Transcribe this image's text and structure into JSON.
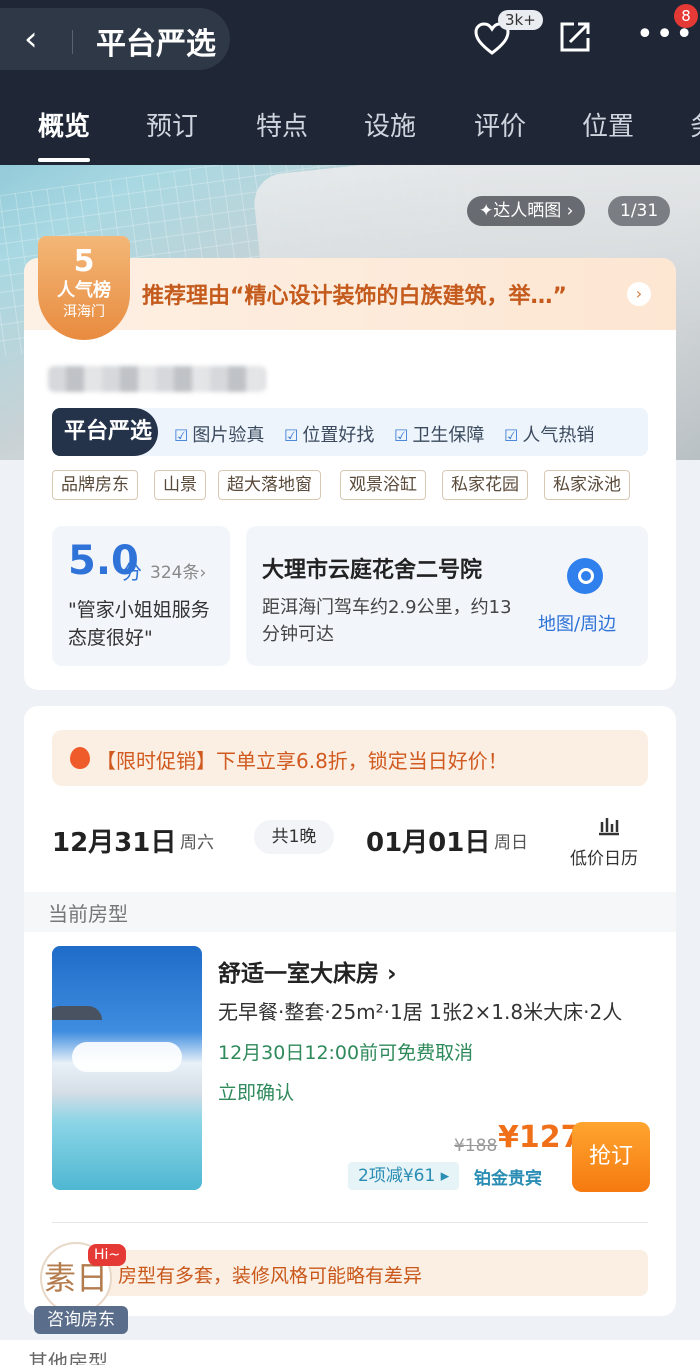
{
  "header": {
    "brand_title": "平台严选",
    "favorites_count": "3k+",
    "notification_count": "8",
    "more_label": "•••"
  },
  "tabs": [
    "概览",
    "预订",
    "特点",
    "设施",
    "评价",
    "位置",
    "务"
  ],
  "gallery": {
    "photo_tag": "✦达人晒图 ›",
    "photo_counter": "1/31"
  },
  "ranking": {
    "number": "5",
    "label": "人气榜",
    "area": "洱海门"
  },
  "recommend": {
    "text": "推荐理由“精心设计装饰的白族建筑，举…”"
  },
  "platform": {
    "logo": "平台严选",
    "guarantees": [
      "图片验真",
      "位置好找",
      "卫生保障",
      "人气热销"
    ]
  },
  "tags": [
    "品牌房东",
    "山景",
    "超大落地窗",
    "观景浴缸",
    "私家花园",
    "私家泳池"
  ],
  "rating": {
    "score": "5.0",
    "unit": "分",
    "count": "324条›",
    "quote": "\"管家小姐姐服务态度很好\""
  },
  "location": {
    "name": "大理市云庭花舍二号院",
    "description": "距洱海门驾车约2.9公里，约13分钟可达",
    "map_label": "地图/周边"
  },
  "promo": {
    "text": "【限时促销】下单立享6.8折，锁定当日好价！"
  },
  "dates": {
    "check_in": "12月31日",
    "check_in_weekday": "周六",
    "nights": "共1晚",
    "check_out": "01月01日",
    "check_out_weekday": "周日",
    "calendar_label": "低价日历"
  },
  "current_room_label": "当前房型",
  "room": {
    "name": "舒适一室大床房 ›",
    "spec": "无早餐·整套·25m²·1居 1张2×1.8米大床·2人",
    "cancel_policy": "12月30日12:00前可免费取消",
    "confirm": "立即确认",
    "price_original": "¥188",
    "price_now": "¥127",
    "discount": "2项减¥61 ▸",
    "member_tier": "铂金贵宾",
    "book_label": "抢订"
  },
  "notice": {
    "text": "房型有多套，装修风格可能略有差异"
  },
  "contact": {
    "avatar_glyph": "素日",
    "hi": "Hi~",
    "label": "咨询房东"
  },
  "other_rooms_label": "其他房型"
}
